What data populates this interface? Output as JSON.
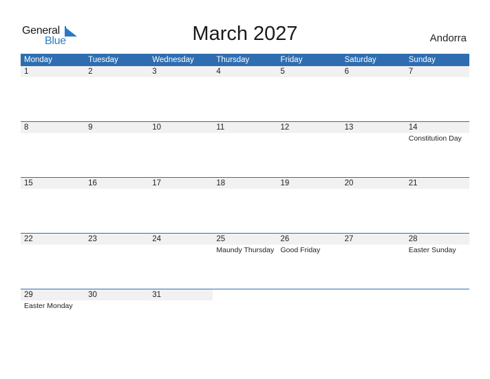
{
  "logo": {
    "general": "General",
    "blue": "Blue",
    "accent_color": "#2a7bc4"
  },
  "title": "March 2027",
  "country": "Andorra",
  "colors": {
    "header_bg": "#2e6eb0",
    "day_bg": "#f1f1f1"
  },
  "weekdays": [
    "Monday",
    "Tuesday",
    "Wednesday",
    "Thursday",
    "Friday",
    "Saturday",
    "Sunday"
  ],
  "weeks": [
    {
      "days": [
        {
          "num": "1",
          "holiday": ""
        },
        {
          "num": "2",
          "holiday": ""
        },
        {
          "num": "3",
          "holiday": ""
        },
        {
          "num": "4",
          "holiday": ""
        },
        {
          "num": "5",
          "holiday": ""
        },
        {
          "num": "6",
          "holiday": ""
        },
        {
          "num": "7",
          "holiday": ""
        }
      ]
    },
    {
      "days": [
        {
          "num": "8",
          "holiday": ""
        },
        {
          "num": "9",
          "holiday": ""
        },
        {
          "num": "10",
          "holiday": ""
        },
        {
          "num": "11",
          "holiday": ""
        },
        {
          "num": "12",
          "holiday": ""
        },
        {
          "num": "13",
          "holiday": ""
        },
        {
          "num": "14",
          "holiday": "Constitution Day"
        }
      ]
    },
    {
      "days": [
        {
          "num": "15",
          "holiday": ""
        },
        {
          "num": "16",
          "holiday": ""
        },
        {
          "num": "17",
          "holiday": ""
        },
        {
          "num": "18",
          "holiday": ""
        },
        {
          "num": "19",
          "holiday": ""
        },
        {
          "num": "20",
          "holiday": ""
        },
        {
          "num": "21",
          "holiday": ""
        }
      ]
    },
    {
      "days": [
        {
          "num": "22",
          "holiday": ""
        },
        {
          "num": "23",
          "holiday": ""
        },
        {
          "num": "24",
          "holiday": ""
        },
        {
          "num": "25",
          "holiday": "Maundy Thursday"
        },
        {
          "num": "26",
          "holiday": "Good Friday"
        },
        {
          "num": "27",
          "holiday": ""
        },
        {
          "num": "28",
          "holiday": "Easter Sunday"
        }
      ]
    },
    {
      "days": [
        {
          "num": "29",
          "holiday": "Easter Monday"
        },
        {
          "num": "30",
          "holiday": ""
        },
        {
          "num": "31",
          "holiday": ""
        },
        {
          "num": "",
          "holiday": ""
        },
        {
          "num": "",
          "holiday": ""
        },
        {
          "num": "",
          "holiday": ""
        },
        {
          "num": "",
          "holiday": ""
        }
      ]
    }
  ]
}
